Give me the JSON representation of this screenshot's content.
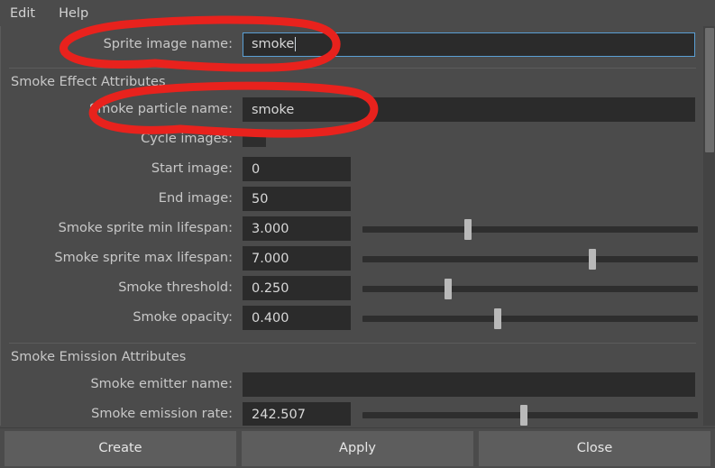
{
  "menubar": {
    "items": [
      {
        "label": "Edit",
        "name": "menu-edit"
      },
      {
        "label": "Help",
        "name": "menu-help"
      }
    ]
  },
  "form": {
    "top_row": {
      "label": "Sprite image name:",
      "value": "smoke",
      "focused": true
    },
    "sections": [
      {
        "title": "Smoke Effect Attributes",
        "rows": [
          {
            "label": "Smoke particle name:",
            "value": "smoke",
            "type": "text-wide"
          },
          {
            "label": "Cycle images:",
            "value": "",
            "type": "checkbox",
            "checked": false
          },
          {
            "label": "Start image:",
            "value": "0",
            "type": "text-short"
          },
          {
            "label": "End image:",
            "value": "50",
            "type": "text-short"
          },
          {
            "label": "Smoke sprite min lifespan:",
            "value": "3.000",
            "type": "text-short-slider",
            "slider_pct": 31
          },
          {
            "label": "Smoke sprite max lifespan:",
            "value": "7.000",
            "type": "text-short-slider",
            "slider_pct": 69
          },
          {
            "label": "Smoke threshold:",
            "value": "0.250",
            "type": "text-short-slider",
            "slider_pct": 25
          },
          {
            "label": "Smoke opacity:",
            "value": "0.400",
            "type": "text-short-slider",
            "slider_pct": 40
          }
        ]
      },
      {
        "title": "Smoke Emission Attributes",
        "rows": [
          {
            "label": "Smoke emitter name:",
            "value": "",
            "type": "text-wide"
          },
          {
            "label": "Smoke emission rate:",
            "value": "242.507",
            "type": "text-short-slider",
            "slider_pct": 48
          }
        ]
      }
    ]
  },
  "buttons": [
    {
      "label": "Create",
      "name": "create-button"
    },
    {
      "label": "Apply",
      "name": "apply-button"
    },
    {
      "label": "Close",
      "name": "close-button"
    }
  ],
  "colors": {
    "panel": "#4b4b4b",
    "field_bg": "#2b2b2b",
    "focus_border": "#5a9fd4",
    "label_text": "#c8c8c8",
    "value_text": "#d8d8d8",
    "button_bg": "#5d5d5d",
    "annotation_red": "#e8221d",
    "slider_handle": "#b9b9b9",
    "groove": "#2e2e2e"
  }
}
